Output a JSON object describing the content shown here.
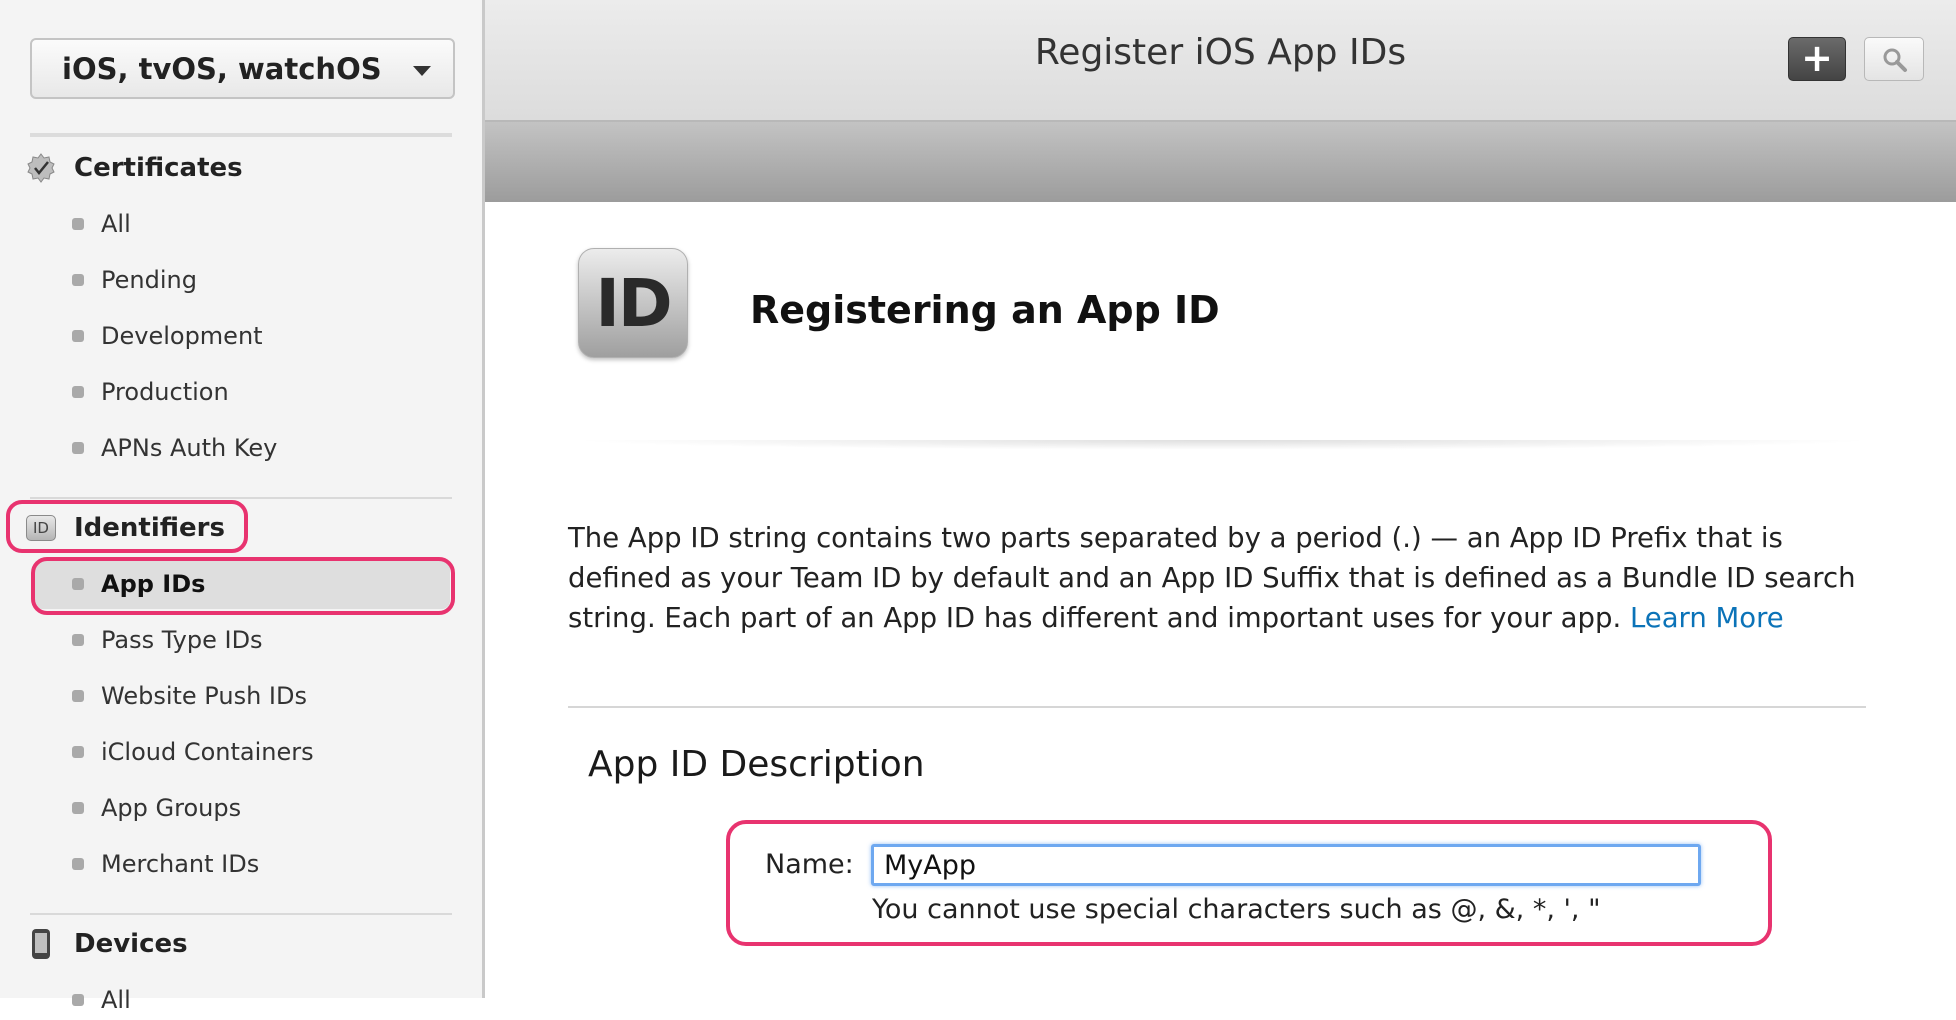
{
  "sidebar": {
    "platform_select": "iOS, tvOS, watchOS",
    "certificates": {
      "label": "Certificates",
      "items": [
        "All",
        "Pending",
        "Development",
        "Production",
        "APNs Auth Key"
      ]
    },
    "identifiers": {
      "label": "Identifiers",
      "icon_text": "ID",
      "items": [
        "App IDs",
        "Pass Type IDs",
        "Website Push IDs",
        "iCloud Containers",
        "App Groups",
        "Merchant IDs"
      ],
      "active": "App IDs"
    },
    "devices": {
      "label": "Devices",
      "items": [
        "All"
      ]
    }
  },
  "header": {
    "title": "Register iOS App IDs",
    "add_label": "+"
  },
  "main": {
    "icon_text": "ID",
    "heading": "Registering an App ID",
    "description": "The App ID string contains two parts separated by a period (.) — an App ID Prefix that is defined as your Team ID by default and an App ID Suffix that is defined as a Bundle ID search string. Each part of an App ID has different and important uses for your app.",
    "learn_more": "Learn More",
    "section_title": "App ID Description",
    "name_label": "Name:",
    "name_value": "MyApp",
    "name_hint": "You cannot use special characters such as @, &, *, ', \""
  },
  "colors": {
    "highlight": "#e8336f",
    "link": "#0b73b8",
    "focus": "#6ea8f0"
  }
}
